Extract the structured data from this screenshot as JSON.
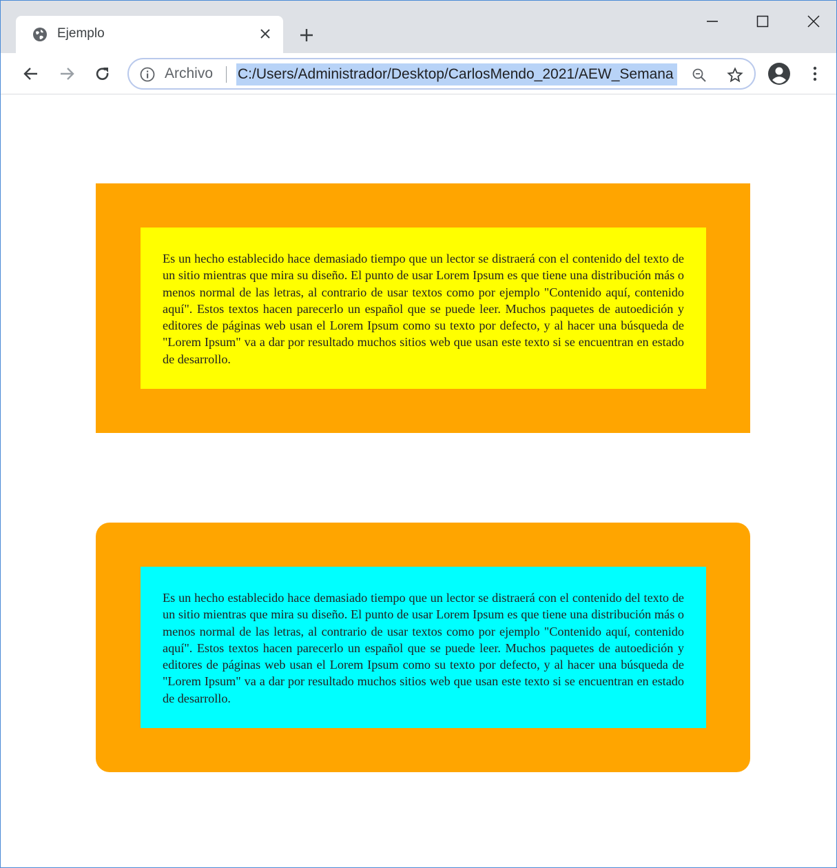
{
  "browser": {
    "tab": {
      "title": "Ejemplo",
      "favicon": "globe-icon",
      "close_icon": "close-icon"
    },
    "new_tab_icon": "plus-icon",
    "window_controls": [
      "minimize-icon",
      "maximize-icon",
      "close-icon"
    ],
    "toolbar": {
      "back_icon": "arrow-left-icon",
      "forward_icon": "arrow-right-icon",
      "reload_icon": "reload-icon",
      "site_info_icon": "info-icon",
      "site_chip": "Archivo",
      "url": "C:/Users/Administrador/Desktop/CarlosMendo_2021/AEW_Semana",
      "zoom_icon": "zoom-out-icon",
      "bookmark_icon": "star-icon",
      "profile_icon": "account-icon",
      "menu_icon": "kebab-menu-icon"
    }
  },
  "page": {
    "boxes": [
      {
        "outer_color": "#ffa500",
        "inner_color": "#ffff00",
        "rounded": false,
        "text": "Es un hecho establecido hace demasiado tiempo que un lector se distraerá con el contenido del texto de un sitio mientras que mira su diseño. El punto de usar Lorem Ipsum es que tiene una distribución más o menos normal de las letras, al contrario de usar textos como por ejemplo \"Contenido aquí, contenido aquí\". Estos textos hacen parecerlo un español que se puede leer. Muchos paquetes de autoedición y editores de páginas web usan el Lorem Ipsum como su texto por defecto, y al hacer una búsqueda de \"Lorem Ipsum\" va a dar por resultado muchos sitios web que usan este texto si se encuentran en estado de desarrollo."
      },
      {
        "outer_color": "#ffa500",
        "inner_color": "#00ffff",
        "rounded": true,
        "text": "Es un hecho establecido hace demasiado tiempo que un lector se distraerá con el contenido del texto de un sitio mientras que mira su diseño. El punto de usar Lorem Ipsum es que tiene una distribución más o menos normal de las letras, al contrario de usar textos como por ejemplo \"Contenido aquí, contenido aquí\". Estos textos hacen parecerlo un español que se puede leer. Muchos paquetes de autoedición y editores de páginas web usan el Lorem Ipsum como su texto por defecto, y al hacer una búsqueda de \"Lorem Ipsum\" va a dar por resultado muchos sitios web que usan este texto si se encuentran en estado de desarrollo."
      }
    ]
  }
}
